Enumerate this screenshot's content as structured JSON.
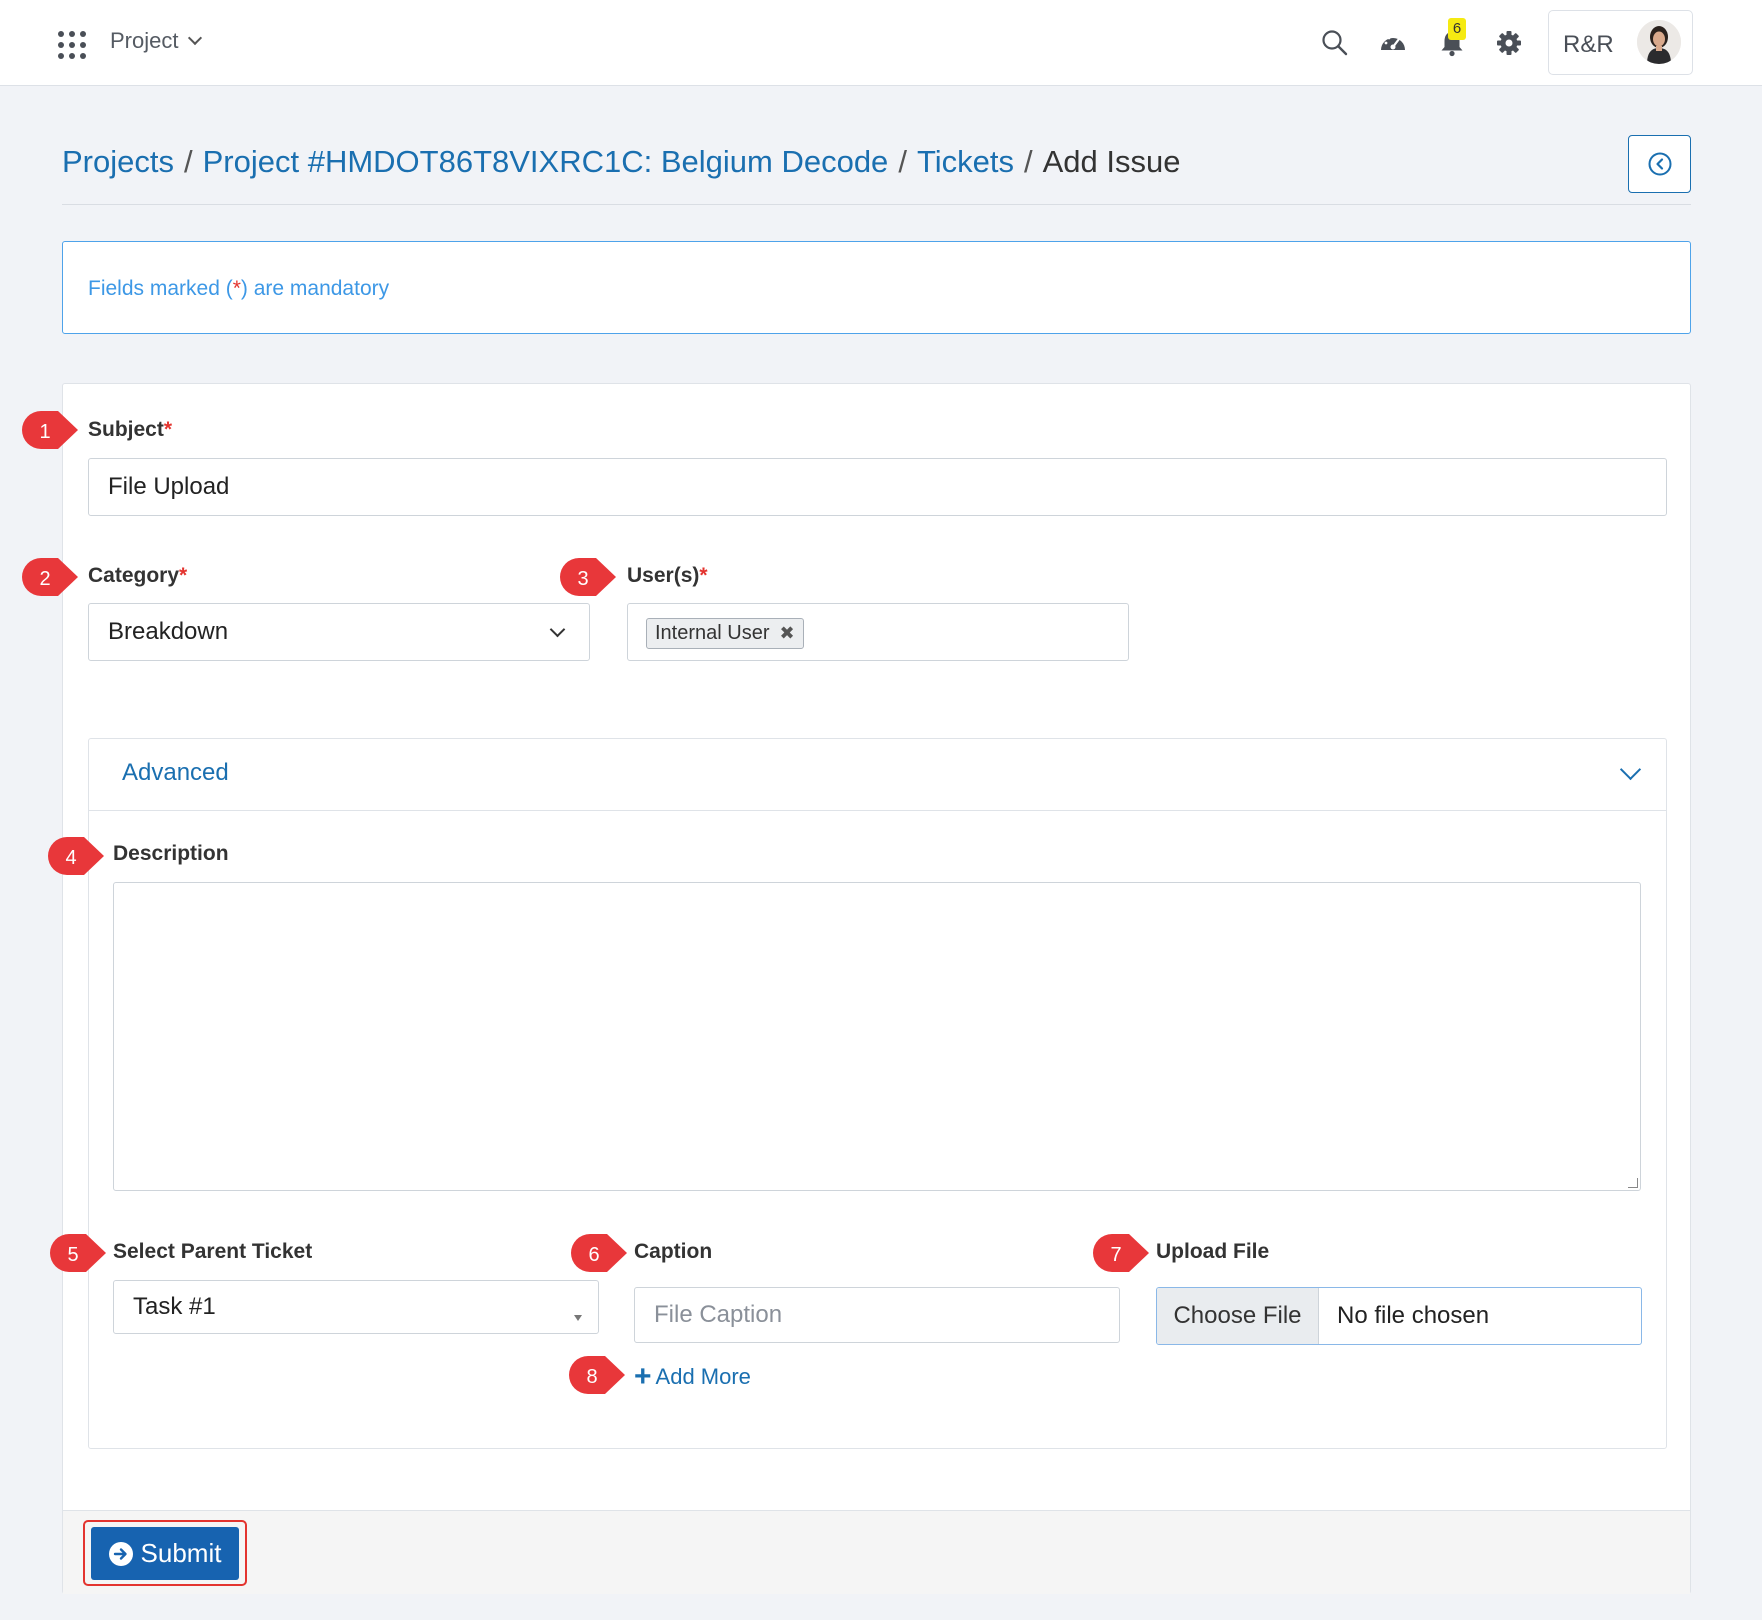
{
  "topbar": {
    "project_menu": "Project",
    "notification_count": "6",
    "user_initials": "R&R"
  },
  "breadcrumb": {
    "items": [
      "Projects",
      "Project #HMDOT86T8VIXRC1C: Belgium Decode",
      "Tickets"
    ],
    "separator": "/",
    "current": "Add Issue"
  },
  "notice": {
    "text_before": "Fields marked (",
    "star": "*",
    "text_after": ") are mandatory"
  },
  "form": {
    "subject_label": "Subject",
    "subject_value": "File Upload",
    "category_label": "Category",
    "category_value": "Breakdown",
    "users_label": "User(s)",
    "user_tag": "Internal User",
    "required_mark": "*",
    "advanced_title": "Advanced",
    "description_label": "Description",
    "parent_ticket_label": "Select Parent Ticket",
    "parent_ticket_value": "Task #1",
    "caption_label": "Caption",
    "caption_placeholder": "File Caption",
    "upload_label": "Upload File",
    "choose_file": "Choose File",
    "file_status": "No file chosen",
    "add_more": "Add More",
    "submit": "Submit"
  },
  "annotations": [
    "1",
    "2",
    "3",
    "4",
    "5",
    "6",
    "7",
    "8"
  ],
  "colors": {
    "link": "#1a6fb0",
    "notice_border": "#4ea3ea",
    "required": "#e3342f",
    "submit_bg": "#1763b0",
    "marker": "#e8373a",
    "badge": "#f5ea12"
  }
}
